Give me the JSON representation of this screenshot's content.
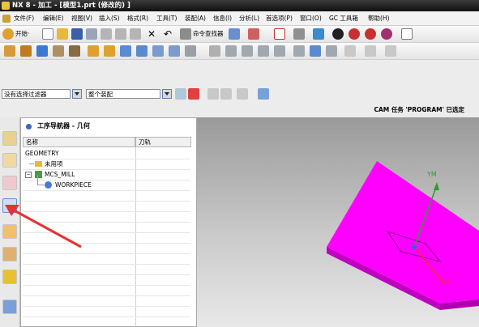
{
  "window": {
    "title": "NX 8 - 加工 - [模型1.prt  (修改的) ]"
  },
  "menubar": {
    "items": [
      "文件(F)",
      "编辑(E)",
      "视图(V)",
      "插入(S)",
      "格式(R)",
      "工具(T)",
      "装配(A)",
      "信息(I)",
      "分析(L)",
      "首选项(P)",
      "窗口(O)",
      "GC 工具箱",
      "帮助(H)"
    ]
  },
  "toolbar": {
    "start_label": "开始·",
    "command_finder_label": "命令查找器"
  },
  "filterbar": {
    "type_filter_value": "没有选择过滤器",
    "scope_value": "整个装配"
  },
  "status": {
    "message": "CAM 任务 'PROGRAM' 已选定"
  },
  "navigator": {
    "title": "工序导航器 - 几何",
    "columns": [
      "名称",
      "刀轨"
    ],
    "rows": [
      {
        "label": "GEOMETRY"
      },
      {
        "label": "未用项"
      },
      {
        "label": "MCS_MILL"
      },
      {
        "label": "WORKPIECE"
      }
    ]
  },
  "viewport": {
    "axis_y_label": "YM",
    "axis_x_label": "XM",
    "part_color": "#ff00ff",
    "axis_y_color": "#2e9b2e",
    "arrow_color": "#e53333"
  }
}
